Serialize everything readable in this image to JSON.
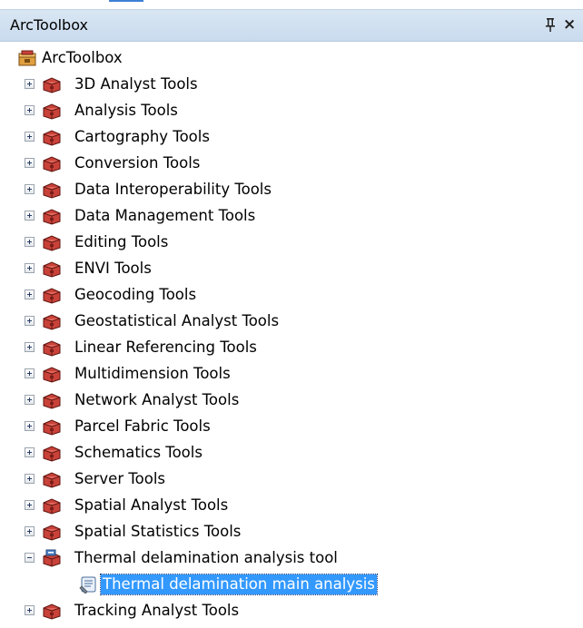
{
  "panel": {
    "title": "ArcToolbox",
    "pin_icon": "pin-icon",
    "close_glyph": "×"
  },
  "tree": {
    "root_label": "ArcToolbox",
    "toolboxes": [
      {
        "label": "3D Analyst Tools",
        "expanded": false
      },
      {
        "label": "Analysis Tools",
        "expanded": false
      },
      {
        "label": "Cartography Tools",
        "expanded": false
      },
      {
        "label": "Conversion Tools",
        "expanded": false
      },
      {
        "label": "Data Interoperability Tools",
        "expanded": false
      },
      {
        "label": "Data Management Tools",
        "expanded": false
      },
      {
        "label": "Editing Tools",
        "expanded": false
      },
      {
        "label": "ENVI Tools",
        "expanded": false
      },
      {
        "label": "Geocoding Tools",
        "expanded": false
      },
      {
        "label": "Geostatistical Analyst Tools",
        "expanded": false
      },
      {
        "label": "Linear Referencing Tools",
        "expanded": false
      },
      {
        "label": "Multidimension Tools",
        "expanded": false
      },
      {
        "label": "Network Analyst Tools",
        "expanded": false
      },
      {
        "label": "Parcel Fabric Tools",
        "expanded": false
      },
      {
        "label": "Schematics Tools",
        "expanded": false
      },
      {
        "label": "Server Tools",
        "expanded": false
      },
      {
        "label": "Spatial Analyst Tools",
        "expanded": false
      },
      {
        "label": "Spatial Statistics Tools",
        "expanded": false
      },
      {
        "label": "Thermal delamination analysis tool",
        "expanded": true
      },
      {
        "label": "Tracking Analyst Tools",
        "expanded": false
      }
    ],
    "custom_script": {
      "label": "Thermal delamination main analysis",
      "selected": true
    }
  },
  "colors": {
    "titlebar": "#d4e3f2",
    "selection": "#3399ff",
    "toolbox_red": "#c0392b"
  }
}
